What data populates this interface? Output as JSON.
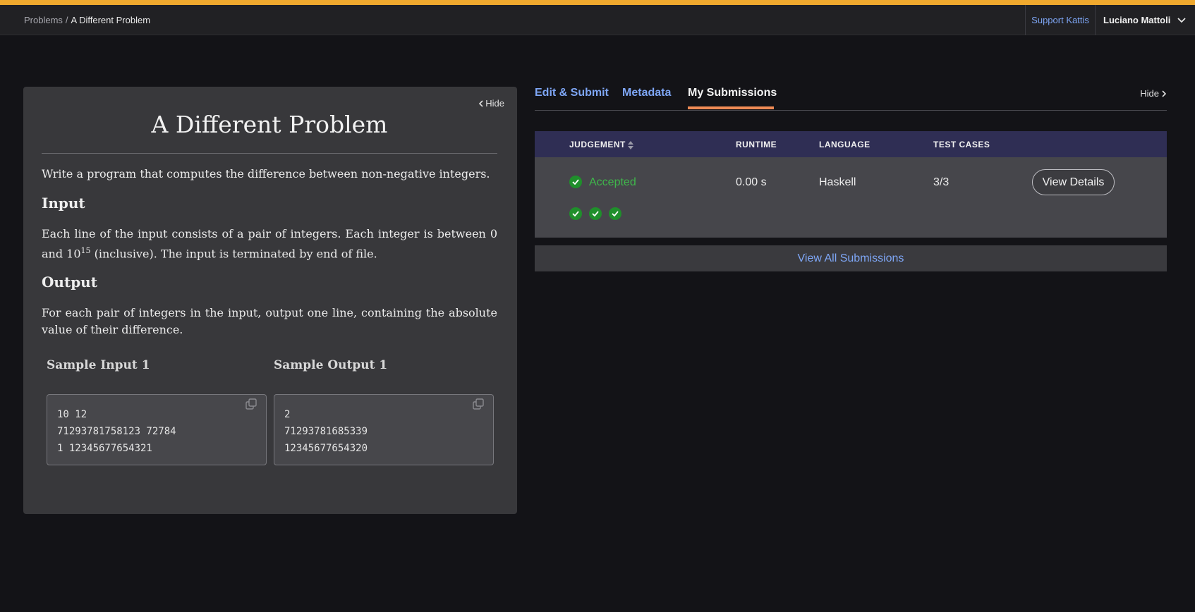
{
  "colors": {
    "accent_top": "#f0a92e",
    "link": "#7ea6f5",
    "success": "#3fb64b",
    "tab_underline": "#ef8b55",
    "table_header": "#2f2e54"
  },
  "breadcrumb": {
    "root": "Problems",
    "separator": "/",
    "current": "A Different Problem"
  },
  "topbar": {
    "support_label": "Support Kattis",
    "user_name": "Luciano Mattoli",
    "user_icon": "chevron-down-icon"
  },
  "problem": {
    "hide_label": "Hide",
    "title": "A Different Problem",
    "intro": "Write a program that computes the difference between non-negative integers.",
    "input_heading": "Input",
    "input_text_a": "Each line of the input consists of a pair of integers. Each integer is between ",
    "input_zero": "0",
    "input_text_b": " and ",
    "input_base": "10",
    "input_exp": "15",
    "input_text_c": " (inclusive). The input is terminated by end of file.",
    "output_heading": "Output",
    "output_text": "For each pair of integers in the input, output one line, containing the absolute value of their difference.",
    "sample_input_label": "Sample Input 1",
    "sample_output_label": "Sample Output 1",
    "sample_input_lines": [
      "10 12",
      "71293781758123 72784",
      "1 12345677654321"
    ],
    "sample_output_lines": [
      "2",
      "71293781685339",
      "12345677654320"
    ]
  },
  "tabs": [
    {
      "label": "Edit & Submit",
      "active": false
    },
    {
      "label": "Metadata",
      "active": false
    },
    {
      "label": "My Submissions",
      "active": true
    }
  ],
  "hide_right_label": "Hide",
  "submissions": {
    "columns": [
      "JUDGEMENT",
      "RUNTIME",
      "LANGUAGE",
      "TEST CASES"
    ],
    "rows": [
      {
        "judgement": "Accepted",
        "runtime": "0.00 s",
        "language": "Haskell",
        "test_cases": "3/3",
        "passed_tests": 3,
        "action": "View Details"
      }
    ],
    "view_all_label": "View All Submissions"
  }
}
